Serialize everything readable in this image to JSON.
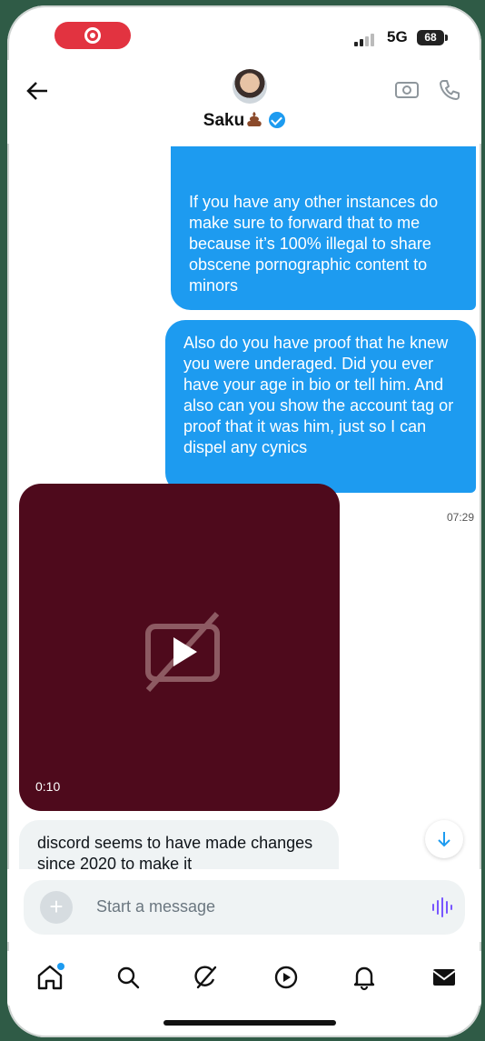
{
  "status_bar": {
    "network": "5G",
    "battery": "68"
  },
  "header": {
    "contact_name": "Saku",
    "verified": true,
    "icons": [
      "back-arrow-icon",
      "video-call-icon",
      "phone-call-icon"
    ]
  },
  "messages": {
    "outgoing_1": "If you have any other instances do make sure to forward that to me because it’s 100% illegal to share obscene pornographic content to minors",
    "outgoing_2": "Also do you have proof that he knew you were underaged. Did you ever have your age in bio or tell him. And also can you show the account tag or proof that it was him, just so I can dispel any cynics",
    "timestamp": "07:29",
    "video_duration": "0:10",
    "incoming_1": "discord seems to have made changes since 2020 to make it"
  },
  "composer": {
    "placeholder": "Start a message"
  },
  "tabs": [
    "home-icon",
    "search-icon",
    "grok-icon",
    "video-icon",
    "notifications-icon",
    "messages-icon"
  ],
  "colors": {
    "accent": "#1d9bf0",
    "video_bg": "#4e0a1c",
    "recording": "#e23340"
  }
}
